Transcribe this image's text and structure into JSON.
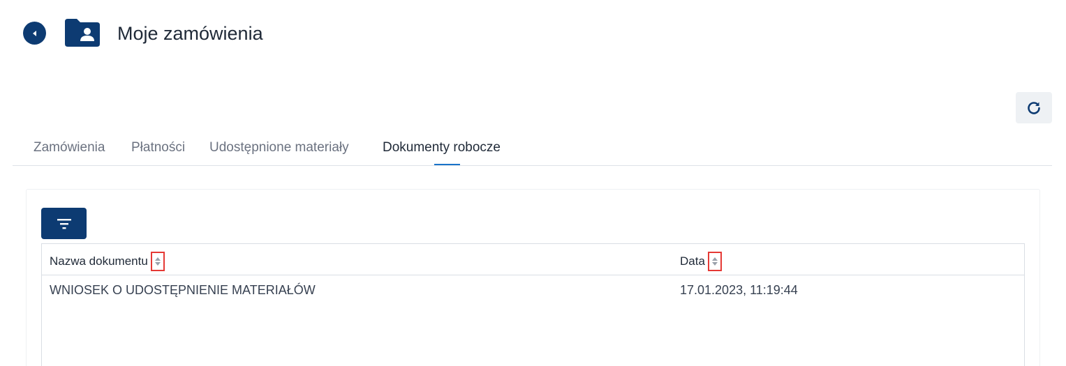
{
  "header": {
    "title": "Moje zamówienia",
    "back_icon": "chevron-left-icon",
    "folder_icon": "folder-user-icon"
  },
  "toolbar": {
    "refresh_icon": "refresh-icon"
  },
  "tabs": [
    {
      "label": "Zamówienia",
      "active": false
    },
    {
      "label": "Płatności",
      "active": false
    },
    {
      "label": "Udostępnione materiały",
      "active": false
    },
    {
      "label": "Dokumenty robocze",
      "active": true
    }
  ],
  "filter": {
    "icon": "filter-icon"
  },
  "table": {
    "columns": [
      {
        "label": "Nazwa dokumentu",
        "sort_icon": "sort-icon"
      },
      {
        "label": "Data",
        "sort_icon": "sort-icon"
      }
    ],
    "rows": [
      {
        "name": "WNIOSEK O UDOSTĘPNIENIE MATERIAŁÓW",
        "date": "17.01.2023, 11:19:44"
      }
    ]
  },
  "colors": {
    "primary": "#0d3b72",
    "tab_indicator": "#1a73c9",
    "sort_highlight": "#e53935"
  }
}
